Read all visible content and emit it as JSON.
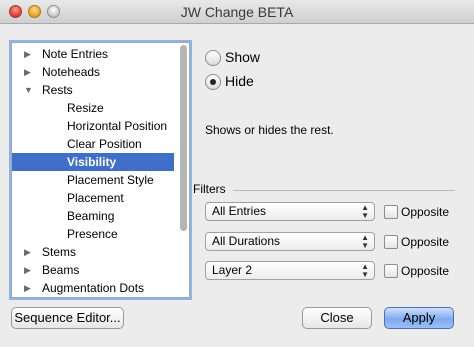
{
  "window": {
    "title": "JW Change BETA"
  },
  "outline": {
    "items": [
      {
        "label": "Note Entries",
        "level": 0,
        "expanded": false,
        "selected": false
      },
      {
        "label": "Noteheads",
        "level": 0,
        "expanded": false,
        "selected": false
      },
      {
        "label": "Rests",
        "level": 0,
        "expanded": true,
        "selected": false
      },
      {
        "label": "Resize",
        "level": 1,
        "selected": false
      },
      {
        "label": "Horizontal Position",
        "level": 1,
        "selected": false
      },
      {
        "label": "Clear Position",
        "level": 1,
        "selected": false
      },
      {
        "label": "Visibility",
        "level": 1,
        "selected": true
      },
      {
        "label": "Placement Style",
        "level": 1,
        "selected": false
      },
      {
        "label": "Placement",
        "level": 1,
        "selected": false
      },
      {
        "label": "Beaming",
        "level": 1,
        "selected": false
      },
      {
        "label": "Presence",
        "level": 1,
        "selected": false
      },
      {
        "label": "Stems",
        "level": 0,
        "expanded": false,
        "selected": false
      },
      {
        "label": "Beams",
        "level": 0,
        "expanded": false,
        "selected": false
      },
      {
        "label": "Augmentation Dots",
        "level": 0,
        "expanded": false,
        "selected": false
      }
    ]
  },
  "options": {
    "show_label": "Show",
    "hide_label": "Hide",
    "selected": "Hide",
    "description": "Shows or hides the rest."
  },
  "filters": {
    "title": "Filters",
    "entries": {
      "value": "All Entries",
      "opposite_label": "Opposite",
      "opposite_checked": false
    },
    "durations": {
      "value": "All Durations",
      "opposite_label": "Opposite",
      "opposite_checked": false
    },
    "layer": {
      "value": "Layer 2",
      "opposite_label": "Opposite",
      "opposite_checked": false
    }
  },
  "buttons": {
    "sequence_editor": "Sequence Editor...",
    "close": "Close",
    "apply": "Apply"
  },
  "icons": {
    "collapsed": "disclosure-triangle-right-icon",
    "expanded": "disclosure-triangle-down-icon",
    "select_arrows": "up-down-arrows-icon"
  },
  "colors": {
    "selection": "#3f6fc9",
    "default_button": "#7faaf0"
  }
}
